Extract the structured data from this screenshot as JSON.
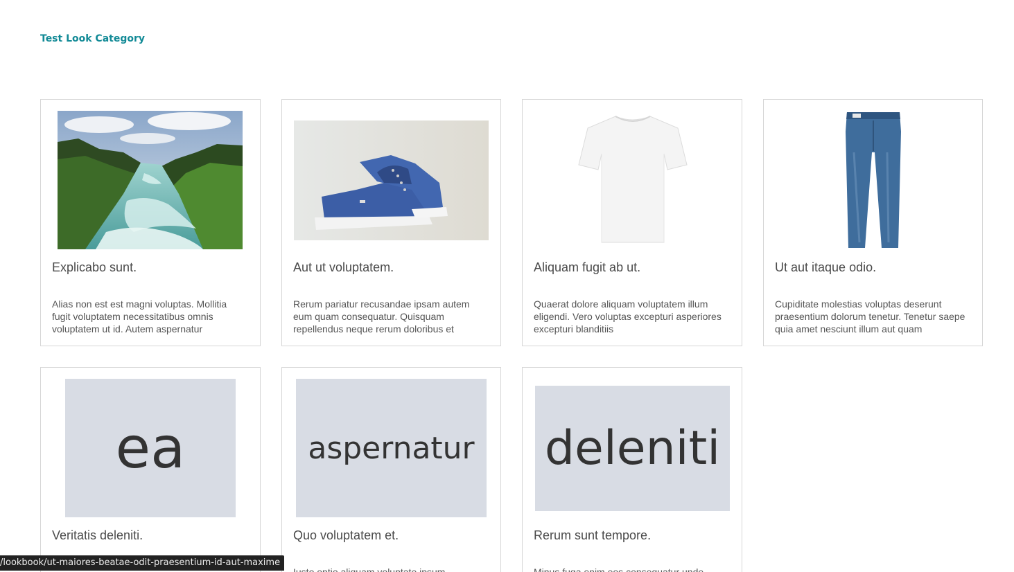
{
  "category": {
    "title": "Test Look Category"
  },
  "cards": [
    {
      "title": "Explicabo sunt.",
      "text": "Alias non est est magni voluptas. Mollitia fugit voluptatem necessitatibus omnis voluptatem ut id. Autem aspernatur",
      "image": "river-waterfall-photo"
    },
    {
      "title": "Aut ut voluptatem.",
      "text": "Rerum pariatur recusandae ipsam autem eum quam consequatur. Quisquam repellendus neque rerum doloribus et",
      "image": "blue-sneakers-photo"
    },
    {
      "title": "Aliquam fugit ab ut.",
      "text": "Quaerat dolore aliquam voluptatem illum eligendi. Vero voluptas excepturi asperiores excepturi blanditiis",
      "image": "white-tshirt-photo"
    },
    {
      "title": "Ut aut itaque odio.",
      "text": "Cupiditate molestias voluptas deserunt praesentium dolorum tenetur. Tenetur saepe quia amet nesciunt illum aut quam",
      "image": "blue-jeans-photo"
    },
    {
      "title": "Veritatis deleniti.",
      "text": "",
      "placeholder": "ea"
    },
    {
      "title": "Quo voluptatem et.",
      "text": "Iusto optio aliquam voluptate ipsum",
      "placeholder": "aspernatur"
    },
    {
      "title": "Rerum sunt tempore.",
      "text": "Minus fuga enim eos consequatur unde",
      "placeholder": "deleniti"
    }
  ],
  "status_bar": {
    "url": "/lookbook/ut-maiores-beatae-odit-praesentium-id-aut-maxime"
  }
}
